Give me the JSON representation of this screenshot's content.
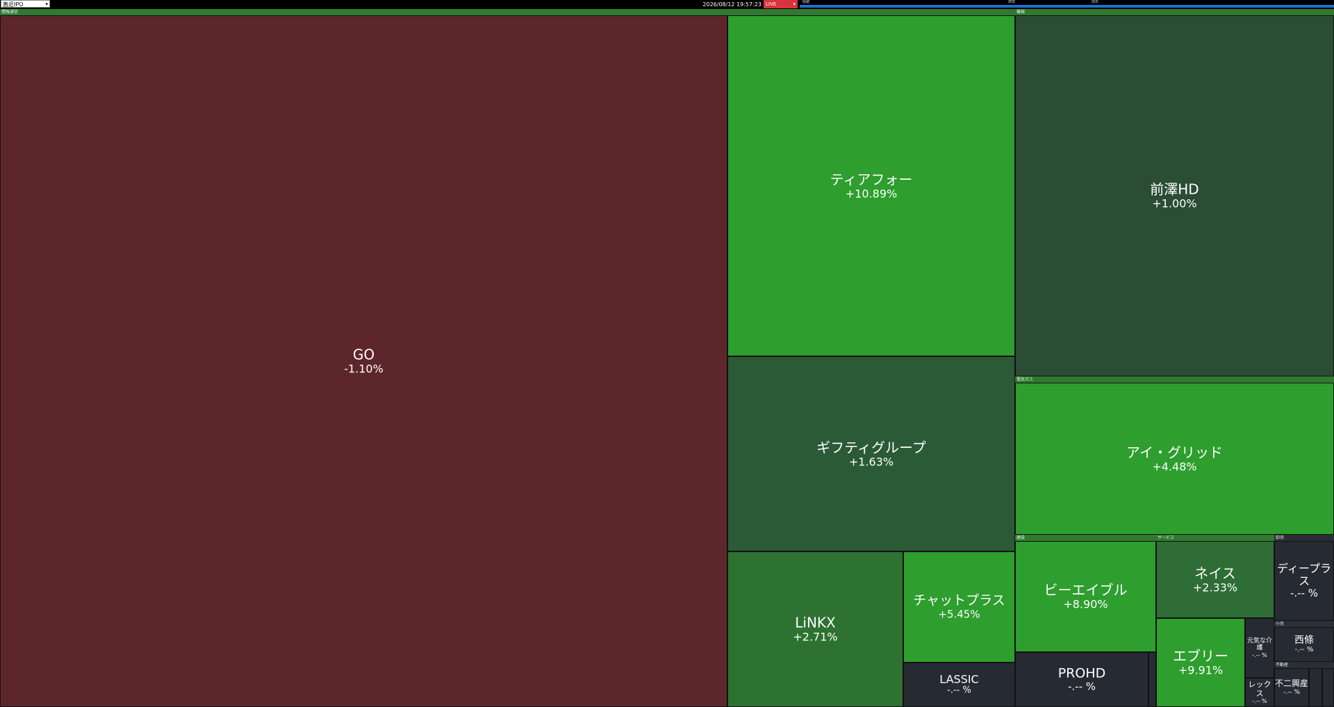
{
  "toolbar": {
    "market_select": "直近IPO",
    "timestamp": "2026/08/12 19:57:23",
    "mode_select": "LIVE"
  },
  "legend": {
    "labels": [
      "始値",
      "高安",
      "前日"
    ],
    "color": "#1f6fd1"
  },
  "sectors": {
    "info_comm": "情報通信",
    "machinery": "機械",
    "electric_gas": "電気ガス",
    "chemical": "建設",
    "service": "サービス",
    "wholesale": "卸売",
    "retail": "小売",
    "realestate": "不動産"
  },
  "tiles": {
    "go": {
      "name": "GO",
      "pct": "-1.10%"
    },
    "tier4": {
      "name": "ティアフォー",
      "pct": "+10.89%"
    },
    "giftee": {
      "name": "ギフティグループ",
      "pct": "+1.63%"
    },
    "linkx": {
      "name": "LiNKX",
      "pct": "+2.71%"
    },
    "chatplus": {
      "name": "チャットプラス",
      "pct": "+5.45%"
    },
    "lassic": {
      "name": "LASSIC",
      "pct": "-.-- %"
    },
    "maezawa": {
      "name": "前澤HD",
      "pct": "+1.00%"
    },
    "igrid": {
      "name": "アイ・グリッド",
      "pct": "+4.48%"
    },
    "beable": {
      "name": "ビーエイブル",
      "pct": "+8.90%"
    },
    "prohd": {
      "name": "PROHD",
      "pct": "-.-- %"
    },
    "neis": {
      "name": "ネイス",
      "pct": "+2.33%"
    },
    "every": {
      "name": "エブリー",
      "pct": "+9.91%"
    },
    "genki": {
      "name": "元気な介護",
      "pct": "-.-- %"
    },
    "rex": {
      "name": "レックス",
      "pct": "-.-- %"
    },
    "dplus": {
      "name": "ディープラス",
      "pct": "-.-- %"
    },
    "nishijo": {
      "name": "西條",
      "pct": "-.-- %"
    },
    "fuji": {
      "name": "不二興産",
      "pct": "-.-- %"
    }
  },
  "colors": {
    "negative": "#5d262b",
    "strong_positive": "#2e9e2e",
    "weak_positive": "#2b5a36",
    "neutral": "#262b33"
  }
}
